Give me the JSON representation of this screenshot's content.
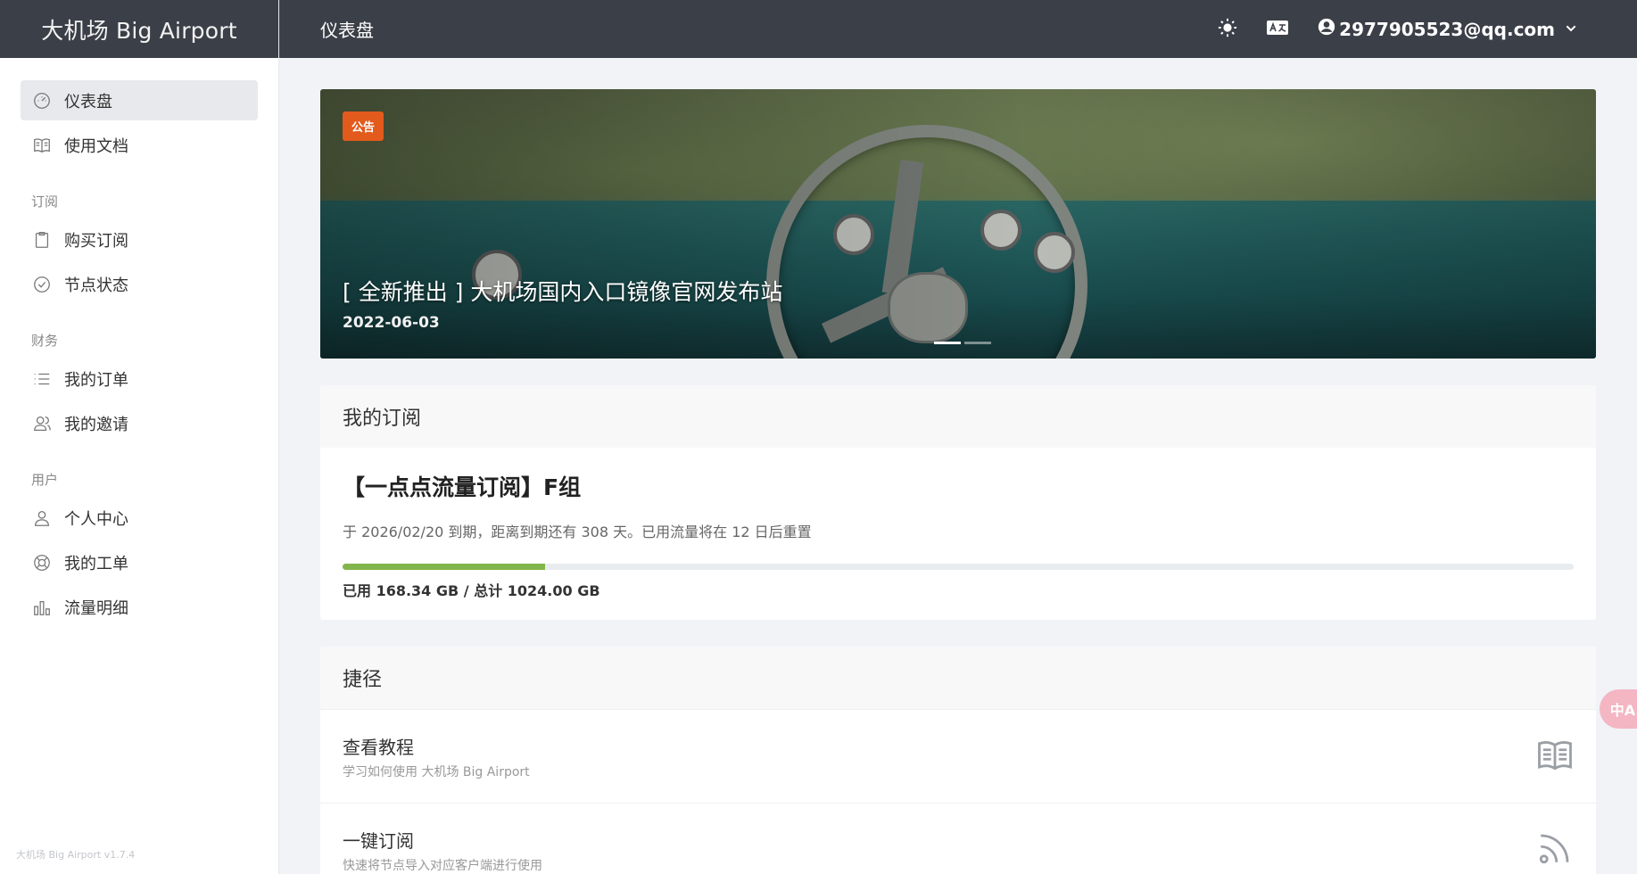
{
  "brand": {
    "name": "大机场 Big Airport",
    "version": "大机场 Big Airport v1.7.4"
  },
  "header": {
    "title": "仪表盘",
    "user_email": "2977905523@qq.com"
  },
  "sidebar": {
    "top_items": [
      {
        "label": "仪表盘",
        "icon": "dashboard-icon",
        "active": true
      },
      {
        "label": "使用文档",
        "icon": "book-icon"
      }
    ],
    "sections": [
      {
        "heading": "订阅",
        "items": [
          {
            "label": "购买订阅",
            "icon": "clipboard-icon"
          },
          {
            "label": "节点状态",
            "icon": "check-circle-icon"
          }
        ]
      },
      {
        "heading": "财务",
        "items": [
          {
            "label": "我的订单",
            "icon": "list-icon"
          },
          {
            "label": "我的邀请",
            "icon": "users-icon"
          }
        ]
      },
      {
        "heading": "用户",
        "items": [
          {
            "label": "个人中心",
            "icon": "user-icon"
          },
          {
            "label": "我的工单",
            "icon": "lifebuoy-icon"
          },
          {
            "label": "流量明细",
            "icon": "bar-chart-icon"
          }
        ]
      }
    ]
  },
  "announcement": {
    "badge": "公告",
    "title": "[ 全新推出 ] 大机场国内入口镜像官网发布站",
    "date": "2022-06-03",
    "slide_count": 2,
    "active_slide": 0
  },
  "subscription": {
    "section_title": "我的订阅",
    "plan_name": "【一点点流量订阅】F组",
    "description": "于 2026/02/20 到期，距离到期还有 308 天。已用流量将在 12 日后重置",
    "used_fraction": 0.1644,
    "usage_text": "已用 168.34 GB / 总计 1024.00 GB",
    "bar_color": "#82b54b"
  },
  "shortcuts": {
    "section_title": "捷径",
    "items": [
      {
        "title": "查看教程",
        "desc": "学习如何使用 大机场 Big Airport",
        "icon": "book-icon"
      },
      {
        "title": "一键订阅",
        "desc": "快速将节点导入对应客户端进行使用",
        "icon": "rss-icon"
      }
    ]
  },
  "floating": {
    "translate_label": "中A"
  },
  "colors": {
    "header_bg": "#3b3f47",
    "accent_badge": "#e25a1c",
    "page_bg": "#f1f3f7"
  }
}
